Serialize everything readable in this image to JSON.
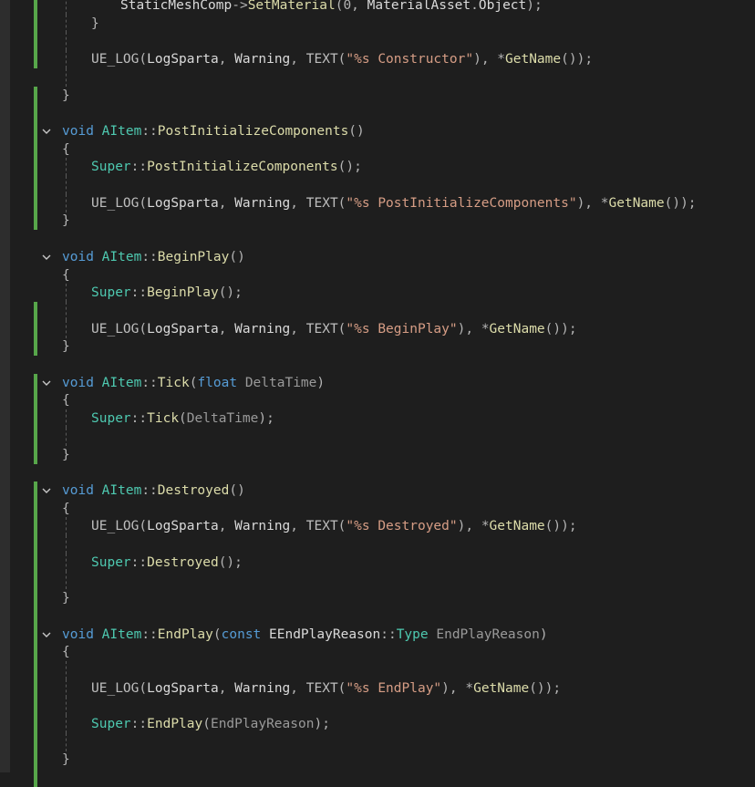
{
  "theme": {
    "background": "#1e1e1e",
    "change_bar": "#57a64a",
    "keyword": "#569cd6",
    "type": "#4ec9b0",
    "function": "#dcdcaa",
    "string": "#d69d85"
  },
  "lines": [
    {
      "fold": false,
      "indent": 2,
      "changed": true,
      "tokens": [
        {
          "t": "StaticMeshComp",
          "c": "plain"
        },
        {
          "t": "->",
          "c": "punct"
        },
        {
          "t": "SetMaterial",
          "c": "func"
        },
        {
          "t": "(0, ",
          "c": "punct"
        },
        {
          "t": "MaterialAsset",
          "c": "plain"
        },
        {
          "t": ".",
          "c": "punct"
        },
        {
          "t": "Object",
          "c": "plain"
        },
        {
          "t": ");",
          "c": "punct"
        }
      ]
    },
    {
      "fold": false,
      "indent": 1,
      "changed": true,
      "tokens": [
        {
          "t": "}",
          "c": "punct"
        }
      ]
    },
    {
      "fold": false,
      "indent": 0,
      "changed": true,
      "tokens": []
    },
    {
      "fold": false,
      "indent": 1,
      "changed": true,
      "tokens": [
        {
          "t": "UE_LOG",
          "c": "macro"
        },
        {
          "t": "(",
          "c": "punct"
        },
        {
          "t": "LogSparta",
          "c": "plain"
        },
        {
          "t": ", ",
          "c": "punct"
        },
        {
          "t": "Warning",
          "c": "plain"
        },
        {
          "t": ", ",
          "c": "punct"
        },
        {
          "t": "TEXT",
          "c": "macro"
        },
        {
          "t": "(",
          "c": "punct"
        },
        {
          "t": "\"%s Constructor\"",
          "c": "string"
        },
        {
          "t": "), *",
          "c": "punct"
        },
        {
          "t": "GetName",
          "c": "func"
        },
        {
          "t": "());",
          "c": "punct"
        }
      ]
    },
    {
      "fold": false,
      "indent": 0,
      "changed": false,
      "tokens": []
    },
    {
      "fold": false,
      "indent": 0,
      "changed": true,
      "tokens": [
        {
          "t": "}",
          "c": "punct"
        }
      ]
    },
    {
      "fold": false,
      "indent": 0,
      "changed": true,
      "tokens": []
    },
    {
      "fold": true,
      "indent": 0,
      "changed": true,
      "tokens": [
        {
          "t": "void ",
          "c": "keyword"
        },
        {
          "t": "AItem",
          "c": "type"
        },
        {
          "t": "::",
          "c": "punct"
        },
        {
          "t": "PostInitializeComponents",
          "c": "func"
        },
        {
          "t": "()",
          "c": "punct"
        }
      ]
    },
    {
      "fold": false,
      "indent": 0,
      "changed": true,
      "tokens": [
        {
          "t": "{",
          "c": "punct"
        }
      ]
    },
    {
      "fold": false,
      "indent": 1,
      "changed": true,
      "tokens": [
        {
          "t": "Super",
          "c": "type"
        },
        {
          "t": "::",
          "c": "punct"
        },
        {
          "t": "PostInitializeComponents",
          "c": "func"
        },
        {
          "t": "();",
          "c": "punct"
        }
      ]
    },
    {
      "fold": false,
      "indent": 0,
      "changed": true,
      "tokens": []
    },
    {
      "fold": false,
      "indent": 1,
      "changed": true,
      "tokens": [
        {
          "t": "UE_LOG",
          "c": "macro"
        },
        {
          "t": "(",
          "c": "punct"
        },
        {
          "t": "LogSparta",
          "c": "plain"
        },
        {
          "t": ", ",
          "c": "punct"
        },
        {
          "t": "Warning",
          "c": "plain"
        },
        {
          "t": ", ",
          "c": "punct"
        },
        {
          "t": "TEXT",
          "c": "macro"
        },
        {
          "t": "(",
          "c": "punct"
        },
        {
          "t": "\"%s PostInitializeComponents\"",
          "c": "string"
        },
        {
          "t": "), *",
          "c": "punct"
        },
        {
          "t": "GetName",
          "c": "func"
        },
        {
          "t": "());",
          "c": "punct"
        }
      ]
    },
    {
      "fold": false,
      "indent": 0,
      "changed": true,
      "tokens": [
        {
          "t": "}",
          "c": "punct"
        }
      ]
    },
    {
      "fold": false,
      "indent": 0,
      "changed": false,
      "tokens": []
    },
    {
      "fold": true,
      "indent": 0,
      "changed": false,
      "tokens": [
        {
          "t": "void ",
          "c": "keyword"
        },
        {
          "t": "AItem",
          "c": "type"
        },
        {
          "t": "::",
          "c": "punct"
        },
        {
          "t": "BeginPlay",
          "c": "func"
        },
        {
          "t": "()",
          "c": "punct"
        }
      ]
    },
    {
      "fold": false,
      "indent": 0,
      "changed": false,
      "tokens": [
        {
          "t": "{",
          "c": "punct"
        }
      ]
    },
    {
      "fold": false,
      "indent": 1,
      "changed": false,
      "tokens": [
        {
          "t": "Super",
          "c": "type"
        },
        {
          "t": "::",
          "c": "punct"
        },
        {
          "t": "BeginPlay",
          "c": "func"
        },
        {
          "t": "();",
          "c": "punct"
        }
      ]
    },
    {
      "fold": false,
      "indent": 0,
      "changed": true,
      "tokens": []
    },
    {
      "fold": false,
      "indent": 1,
      "changed": true,
      "tokens": [
        {
          "t": "UE_LOG",
          "c": "macro"
        },
        {
          "t": "(",
          "c": "punct"
        },
        {
          "t": "LogSparta",
          "c": "plain"
        },
        {
          "t": ", ",
          "c": "punct"
        },
        {
          "t": "Warning",
          "c": "plain"
        },
        {
          "t": ", ",
          "c": "punct"
        },
        {
          "t": "TEXT",
          "c": "macro"
        },
        {
          "t": "(",
          "c": "punct"
        },
        {
          "t": "\"%s BeginPlay\"",
          "c": "string"
        },
        {
          "t": "), *",
          "c": "punct"
        },
        {
          "t": "GetName",
          "c": "func"
        },
        {
          "t": "());",
          "c": "punct"
        }
      ]
    },
    {
      "fold": false,
      "indent": 0,
      "changed": true,
      "tokens": [
        {
          "t": "}",
          "c": "punct"
        }
      ]
    },
    {
      "fold": false,
      "indent": 0,
      "changed": false,
      "tokens": []
    },
    {
      "fold": true,
      "indent": 0,
      "changed": true,
      "tokens": [
        {
          "t": "void ",
          "c": "keyword"
        },
        {
          "t": "AItem",
          "c": "type"
        },
        {
          "t": "::",
          "c": "punct"
        },
        {
          "t": "Tick",
          "c": "func"
        },
        {
          "t": "(",
          "c": "punct"
        },
        {
          "t": "float ",
          "c": "keyword"
        },
        {
          "t": "DeltaTime",
          "c": "param"
        },
        {
          "t": ")",
          "c": "punct"
        }
      ]
    },
    {
      "fold": false,
      "indent": 0,
      "changed": true,
      "tokens": [
        {
          "t": "{",
          "c": "punct"
        }
      ]
    },
    {
      "fold": false,
      "indent": 1,
      "changed": true,
      "tokens": [
        {
          "t": "Super",
          "c": "type"
        },
        {
          "t": "::",
          "c": "punct"
        },
        {
          "t": "Tick",
          "c": "func"
        },
        {
          "t": "(",
          "c": "punct"
        },
        {
          "t": "DeltaTime",
          "c": "param"
        },
        {
          "t": ");",
          "c": "punct"
        }
      ]
    },
    {
      "fold": false,
      "indent": 0,
      "changed": true,
      "tokens": []
    },
    {
      "fold": false,
      "indent": 0,
      "changed": true,
      "tokens": [
        {
          "t": "}",
          "c": "punct"
        }
      ]
    },
    {
      "fold": false,
      "indent": 0,
      "changed": false,
      "tokens": []
    },
    {
      "fold": true,
      "indent": 0,
      "changed": true,
      "tokens": [
        {
          "t": "void ",
          "c": "keyword"
        },
        {
          "t": "AItem",
          "c": "type"
        },
        {
          "t": "::",
          "c": "punct"
        },
        {
          "t": "Destroyed",
          "c": "func"
        },
        {
          "t": "()",
          "c": "punct"
        }
      ]
    },
    {
      "fold": false,
      "indent": 0,
      "changed": true,
      "tokens": [
        {
          "t": "{",
          "c": "punct"
        }
      ]
    },
    {
      "fold": false,
      "indent": 1,
      "changed": true,
      "tokens": [
        {
          "t": "UE_LOG",
          "c": "macro"
        },
        {
          "t": "(",
          "c": "punct"
        },
        {
          "t": "LogSparta",
          "c": "plain"
        },
        {
          "t": ", ",
          "c": "punct"
        },
        {
          "t": "Warning",
          "c": "plain"
        },
        {
          "t": ", ",
          "c": "punct"
        },
        {
          "t": "TEXT",
          "c": "macro"
        },
        {
          "t": "(",
          "c": "punct"
        },
        {
          "t": "\"%s Destroyed\"",
          "c": "string"
        },
        {
          "t": "), *",
          "c": "punct"
        },
        {
          "t": "GetName",
          "c": "func"
        },
        {
          "t": "());",
          "c": "punct"
        }
      ]
    },
    {
      "fold": false,
      "indent": 0,
      "changed": true,
      "tokens": []
    },
    {
      "fold": false,
      "indent": 1,
      "changed": true,
      "tokens": [
        {
          "t": "Super",
          "c": "type"
        },
        {
          "t": "::",
          "c": "punct"
        },
        {
          "t": "Destroyed",
          "c": "func"
        },
        {
          "t": "();",
          "c": "punct"
        }
      ]
    },
    {
      "fold": false,
      "indent": 0,
      "changed": true,
      "tokens": []
    },
    {
      "fold": false,
      "indent": 0,
      "changed": true,
      "tokens": [
        {
          "t": "}",
          "c": "punct"
        }
      ]
    },
    {
      "fold": false,
      "indent": 0,
      "changed": true,
      "tokens": []
    },
    {
      "fold": true,
      "indent": 0,
      "changed": true,
      "tokens": [
        {
          "t": "void ",
          "c": "keyword"
        },
        {
          "t": "AItem",
          "c": "type"
        },
        {
          "t": "::",
          "c": "punct"
        },
        {
          "t": "EndPlay",
          "c": "func"
        },
        {
          "t": "(",
          "c": "punct"
        },
        {
          "t": "const ",
          "c": "keyword"
        },
        {
          "t": "EEndPlayReason",
          "c": "plain"
        },
        {
          "t": "::",
          "c": "punct"
        },
        {
          "t": "Type ",
          "c": "type"
        },
        {
          "t": "EndPlayReason",
          "c": "param"
        },
        {
          "t": ")",
          "c": "punct"
        }
      ]
    },
    {
      "fold": false,
      "indent": 0,
      "changed": true,
      "tokens": [
        {
          "t": "{",
          "c": "punct"
        }
      ]
    },
    {
      "fold": false,
      "indent": 0,
      "changed": true,
      "tokens": []
    },
    {
      "fold": false,
      "indent": 1,
      "changed": true,
      "tokens": [
        {
          "t": "UE_LOG",
          "c": "macro"
        },
        {
          "t": "(",
          "c": "punct"
        },
        {
          "t": "LogSparta",
          "c": "plain"
        },
        {
          "t": ", ",
          "c": "punct"
        },
        {
          "t": "Warning",
          "c": "plain"
        },
        {
          "t": ", ",
          "c": "punct"
        },
        {
          "t": "TEXT",
          "c": "macro"
        },
        {
          "t": "(",
          "c": "punct"
        },
        {
          "t": "\"%s EndPlay\"",
          "c": "string"
        },
        {
          "t": "), *",
          "c": "punct"
        },
        {
          "t": "GetName",
          "c": "func"
        },
        {
          "t": "());",
          "c": "punct"
        }
      ]
    },
    {
      "fold": false,
      "indent": 0,
      "changed": true,
      "tokens": []
    },
    {
      "fold": false,
      "indent": 1,
      "changed": true,
      "tokens": [
        {
          "t": "Super",
          "c": "type"
        },
        {
          "t": "::",
          "c": "punct"
        },
        {
          "t": "EndPlay",
          "c": "func"
        },
        {
          "t": "(",
          "c": "punct"
        },
        {
          "t": "EndPlayReason",
          "c": "param"
        },
        {
          "t": ");",
          "c": "punct"
        }
      ]
    },
    {
      "fold": false,
      "indent": 0,
      "changed": true,
      "tokens": []
    },
    {
      "fold": false,
      "indent": 0,
      "changed": true,
      "tokens": [
        {
          "t": "}",
          "c": "punct"
        }
      ]
    },
    {
      "fold": false,
      "indent": 0,
      "changed": true,
      "tokens": []
    }
  ]
}
